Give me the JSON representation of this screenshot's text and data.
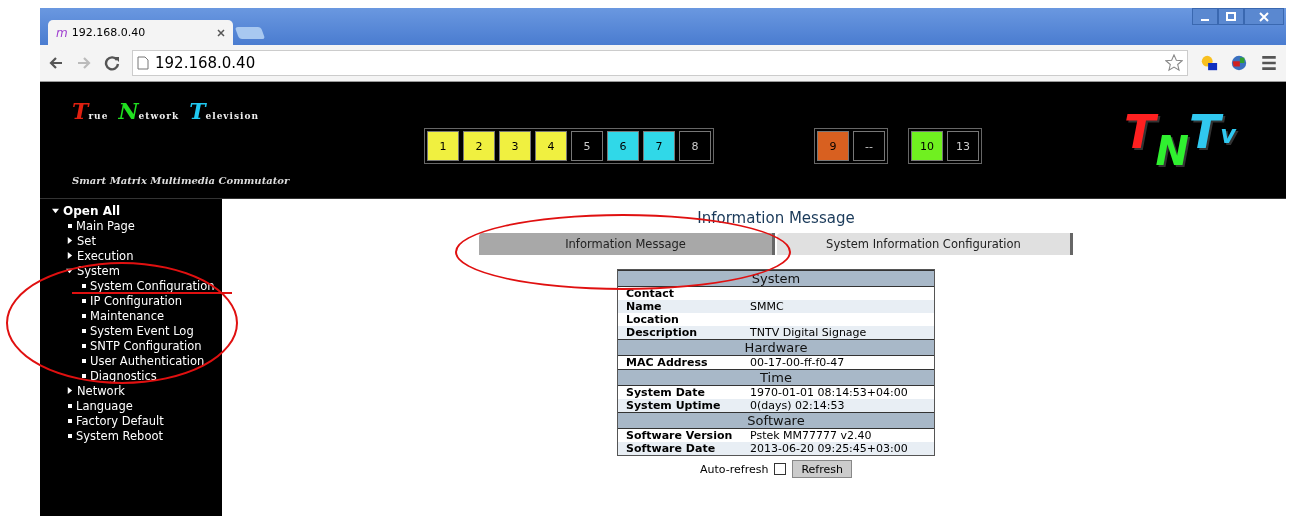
{
  "browser": {
    "tab_title": "192.168.0.40",
    "tab_icon": "m",
    "address": "192.168.0.40"
  },
  "header": {
    "brand": [
      {
        "initial": "T",
        "rest": "rue",
        "color": "#e02010"
      },
      {
        "initial": "N",
        "rest": "etwork",
        "color": "#20e020"
      },
      {
        "initial": "T",
        "rest": "elevision",
        "color": "#20c8f0"
      }
    ],
    "tagline": "Smart Matrix Multimedia Commutator",
    "port_groups": [
      [
        {
          "label": "1",
          "color": "#f0f040"
        },
        {
          "label": "2",
          "color": "#f0f040"
        },
        {
          "label": "3",
          "color": "#f0f040"
        },
        {
          "label": "4",
          "color": "#f0f040"
        },
        {
          "label": "5",
          "color": "#000000"
        },
        {
          "label": "6",
          "color": "#30d8e8"
        },
        {
          "label": "7",
          "color": "#30d8e8"
        },
        {
          "label": "8",
          "color": "#000000"
        }
      ],
      [
        {
          "label": "9",
          "color": "#d86020"
        },
        {
          "label": "--",
          "color": "#000000"
        }
      ],
      [
        {
          "label": "10",
          "color": "#70f020"
        },
        {
          "label": "13",
          "color": "#000000"
        }
      ]
    ],
    "logo": [
      {
        "letter": "T",
        "color": "#ff2020"
      },
      {
        "letter": "N",
        "color": "#30f030"
      },
      {
        "letter": "T",
        "color": "#30c8f0"
      },
      {
        "letter": "v",
        "color": "#30c8f0"
      }
    ]
  },
  "sidebar": {
    "items": [
      {
        "label": "Open All",
        "kind": "folder",
        "expanded": true,
        "children": [
          {
            "label": "Main Page",
            "kind": "page"
          },
          {
            "label": "Set",
            "kind": "folder",
            "expanded": false
          },
          {
            "label": "Execution",
            "kind": "folder",
            "expanded": false
          },
          {
            "label": "System",
            "kind": "folder",
            "expanded": true,
            "children": [
              {
                "label": "System Configuration",
                "kind": "page"
              },
              {
                "label": "IP Configuration",
                "kind": "page"
              },
              {
                "label": "Maintenance",
                "kind": "page"
              },
              {
                "label": "System Event Log",
                "kind": "page"
              },
              {
                "label": "SNTP Configuration",
                "kind": "page"
              },
              {
                "label": "User Authentication",
                "kind": "page"
              },
              {
                "label": "Diagnostics",
                "kind": "page"
              }
            ]
          },
          {
            "label": "Network",
            "kind": "folder",
            "expanded": false
          },
          {
            "label": "Language",
            "kind": "page"
          },
          {
            "label": "Factory Default",
            "kind": "page"
          },
          {
            "label": "System Reboot",
            "kind": "page"
          }
        ]
      }
    ]
  },
  "page_title": "Information Message",
  "tabs": [
    {
      "label": "Information Message",
      "selected": true
    },
    {
      "label": "System Information Configuration",
      "selected": false
    }
  ],
  "info_table": [
    {
      "title": "System",
      "rows": [
        {
          "label": "Contact",
          "value": ""
        },
        {
          "label": "Name",
          "value": "SMMC"
        },
        {
          "label": "Location",
          "value": ""
        },
        {
          "label": "Description",
          "value": "TNTV Digital Signage"
        }
      ]
    },
    {
      "title": "Hardware",
      "rows": [
        {
          "label": "MAC Address",
          "value": "00-17-00-ff-f0-47"
        }
      ]
    },
    {
      "title": "Time",
      "rows": [
        {
          "label": "System Date",
          "value": "1970-01-01 08:14:53+04:00"
        },
        {
          "label": "System Uptime",
          "value": "0(days) 02:14:53"
        }
      ]
    },
    {
      "title": "Software",
      "rows": [
        {
          "label": "Software Version",
          "value": "Pstek MM77777 v2.40"
        },
        {
          "label": "Software Date",
          "value": "2013-06-20 09:25:45+03:00"
        }
      ]
    }
  ],
  "auto_refresh": {
    "label": "Auto-refresh",
    "checked": false
  },
  "refresh_button": "Refresh",
  "annotations": [
    {
      "kind": "ellipse"
    },
    {
      "kind": "ellipse"
    },
    {
      "kind": "underline"
    }
  ]
}
